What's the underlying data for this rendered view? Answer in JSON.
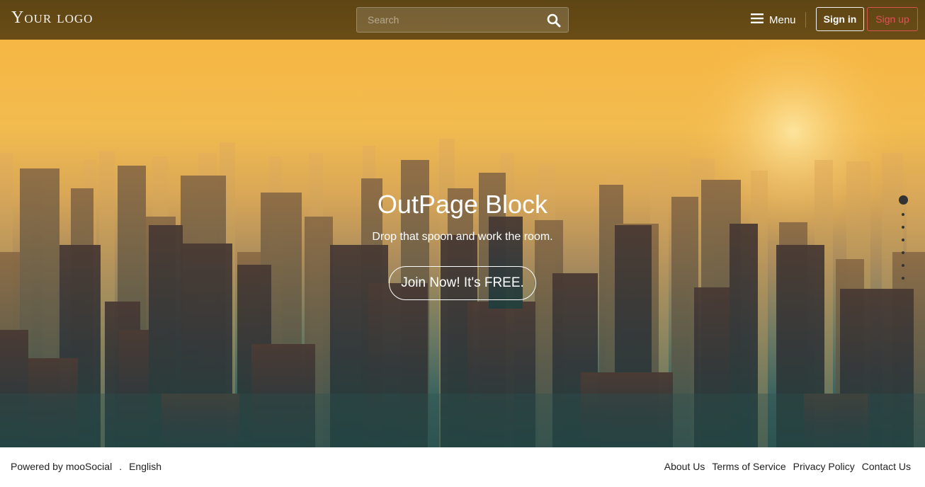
{
  "header": {
    "logo": "Your logo",
    "search": {
      "placeholder": "Search",
      "value": ""
    },
    "menu_label": "Menu",
    "signin_label": "Sign in",
    "signup_label": "Sign up"
  },
  "hero": {
    "title": "OutPage Block",
    "subtitle": "Drop that spoon and work the room.",
    "cta_label": "Join Now! It's FREE.",
    "slides_count": 7,
    "active_slide": 1
  },
  "footer": {
    "powered_by": "Powered by mooSocial",
    "separator": ".",
    "language": "English",
    "links": [
      "About Us",
      "Terms of Service",
      "Privacy Policy",
      "Contact Us"
    ]
  },
  "colors": {
    "header_bg": "#654a15",
    "signup_accent": "#e0505a",
    "hero_top": "#f6b743",
    "hero_bottom": "#2c5552"
  }
}
